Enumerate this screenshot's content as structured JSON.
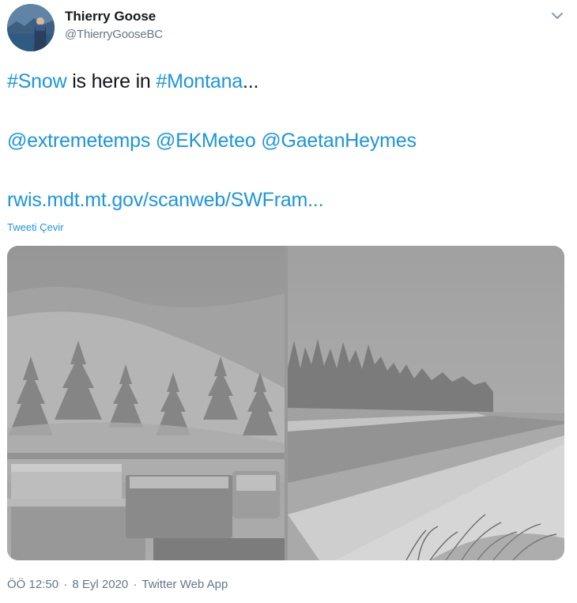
{
  "user": {
    "name": "Thierry Goose",
    "handle": "@ThierryGooseBC"
  },
  "tweet": {
    "line1": {
      "hashtag1": "#Snow",
      "middle": " is here in ",
      "hashtag2": "#Montana",
      "ellipsis": "..."
    },
    "mentions": [
      "@extremetemps",
      "@EKMeteo",
      "@GaetanHeymes"
    ],
    "link": "rwis.mdt.mt.gov/scanweb/SWFram...",
    "translate_label": "Tweeti Çevir"
  },
  "media": {
    "photos": [
      {
        "description": "snowy roadside with trucks and pine forest"
      },
      {
        "description": "snowy highway with pine trees in fog"
      }
    ]
  },
  "footer": {
    "time": "ÖÖ 12:50",
    "date": "8 Eyl 2020",
    "source": "Twitter Web App",
    "separator": "·"
  },
  "icons": {
    "menu": "chevron-down-icon"
  },
  "colors": {
    "link": "#1b95e0",
    "text": "#14171a",
    "muted": "#657786"
  }
}
